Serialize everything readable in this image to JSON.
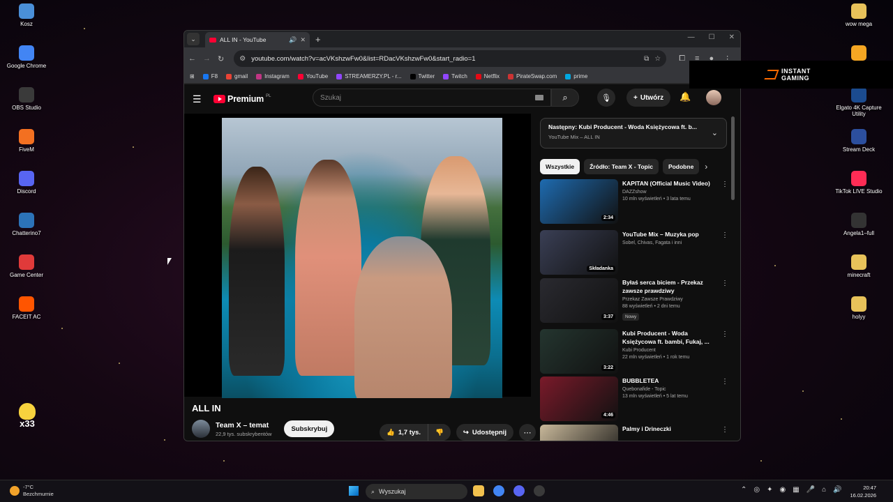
{
  "desktop": {
    "icons_left": [
      {
        "label": "Kosz",
        "icon": "recycle-bin-icon",
        "color": "#4a8fd8"
      },
      {
        "label": "Google Chrome",
        "icon": "chrome-icon",
        "color": "#4285f4"
      },
      {
        "label": "OBS Studio",
        "icon": "obs-icon",
        "color": "#3a3a3a"
      },
      {
        "label": "FiveM",
        "icon": "fivem-icon",
        "color": "#f37021"
      },
      {
        "label": "Discord",
        "icon": "discord-icon",
        "color": "#5865f2"
      },
      {
        "label": "Chatterino7",
        "icon": "chatterino-icon",
        "color": "#2c73b8"
      },
      {
        "label": "Game Center",
        "icon": "game-center-icon",
        "color": "#e03a3a"
      },
      {
        "label": "FACEIT AC",
        "icon": "faceit-icon",
        "color": "#ff5500"
      }
    ],
    "icons_right": [
      {
        "label": "wow mega",
        "icon": "folder-icon",
        "color": "#e8c25a"
      },
      {
        "label": "",
        "icon": "sun-app-icon",
        "color": "#f5a623"
      },
      {
        "label": "Elgato 4K Capture Utility",
        "icon": "elgato-icon",
        "color": "#1b4b8f"
      },
      {
        "label": "Stream Deck",
        "icon": "stream-deck-icon",
        "color": "#2c4f9e"
      },
      {
        "label": "TikTok LIVE Studio",
        "icon": "tiktok-icon",
        "color": "#fe2c55"
      },
      {
        "label": "Angela1–full",
        "icon": "file-icon",
        "color": "#333333"
      },
      {
        "label": "minecraft",
        "icon": "folder-icon",
        "color": "#e8c25a"
      },
      {
        "label": "holyy",
        "icon": "folder-icon",
        "color": "#e8c25a"
      }
    ],
    "duck_label": "x33"
  },
  "browser": {
    "tab_title": "ALL IN - YouTube",
    "url": "youtube.com/watch?v=acVKshzwFw0&list=RDacVKshzwFw0&start_radio=1",
    "bookmarks": [
      {
        "label": "F8",
        "color": "#1877f2"
      },
      {
        "label": "gmail",
        "color": "#ea4335"
      },
      {
        "label": "Instagram",
        "color": "#c13584"
      },
      {
        "label": "YouTube",
        "color": "#ff0033"
      },
      {
        "label": "STREAMERZY.PL - r...",
        "color": "#9146ff"
      },
      {
        "label": "Twitter",
        "color": "#000000"
      },
      {
        "label": "Twitch",
        "color": "#9146ff"
      },
      {
        "label": "Netflix",
        "color": "#e50914"
      },
      {
        "label": "PirateSwap.com",
        "color": "#cc3333"
      },
      {
        "label": "prime",
        "color": "#00a8e1"
      }
    ]
  },
  "youtube": {
    "brand": "Premium",
    "region": "PL",
    "search_placeholder": "Szukaj",
    "create_label": "Utwórz",
    "video_title": "ALL IN",
    "channel_name": "Team X – temat",
    "channel_subs": "22,9 tys. subskrybentów",
    "subscribe_label": "Subskrybuj",
    "likes": "1,7 tys.",
    "share_label": "Udostępnij",
    "next_title": "Następny: Kubi Producent - Woda Księżycowa ft. b...",
    "next_sub": "YouTube Mix – ALL IN",
    "chips": [
      "Wszystkie",
      "Źródło: Team X - Topic",
      "Podobne"
    ],
    "recommendations": [
      {
        "title": "KAPITAN (Official Music Video)",
        "channel": "DAZZshow",
        "meta": "10 mln wyświetleń • 3 lata temu",
        "duration": "2:34",
        "badge": "",
        "color": "#1e6bb0"
      },
      {
        "title": "YouTube Mix – Muzyka pop",
        "channel": "Sobel, Chivas, Fagata i inni",
        "meta": "",
        "duration": "Składanka",
        "badge": "",
        "color": "#3a3f55"
      },
      {
        "title": "Byłaś serca biciem - Przekaz zawsze prawdziwy",
        "channel": "Przekaz Zawsze Prawdziwy",
        "meta": "88 wyświetleń • 2 dni temu",
        "duration": "3:37",
        "badge": "Nowy",
        "color": "#2a2a30"
      },
      {
        "title": "Kubi Producent - Woda Księżycowa ft. bambi, Fukaj, ...",
        "channel": "Kubi Producent",
        "meta": "22 mln wyświetleń • 1 rok temu",
        "duration": "3:22",
        "badge": "",
        "color": "#24352f"
      },
      {
        "title": "BUBBLETEA",
        "channel": "Quebonafide - Topic",
        "meta": "13 mln wyświetleń • 5 lat temu",
        "duration": "4:46",
        "badge": "",
        "color": "#7a1a2a"
      },
      {
        "title": "Palmy i Drineczki",
        "channel": "",
        "meta": "",
        "duration": "",
        "badge": "",
        "color": "#c8b89a"
      }
    ]
  },
  "ad": {
    "line1": "INSTANT",
    "line2": "GAMING"
  },
  "taskbar": {
    "temp": "-7°C",
    "weather": "Bezchmurnie",
    "search_label": "Wyszukaj",
    "time": "20:47",
    "date": "16.02.2026"
  }
}
